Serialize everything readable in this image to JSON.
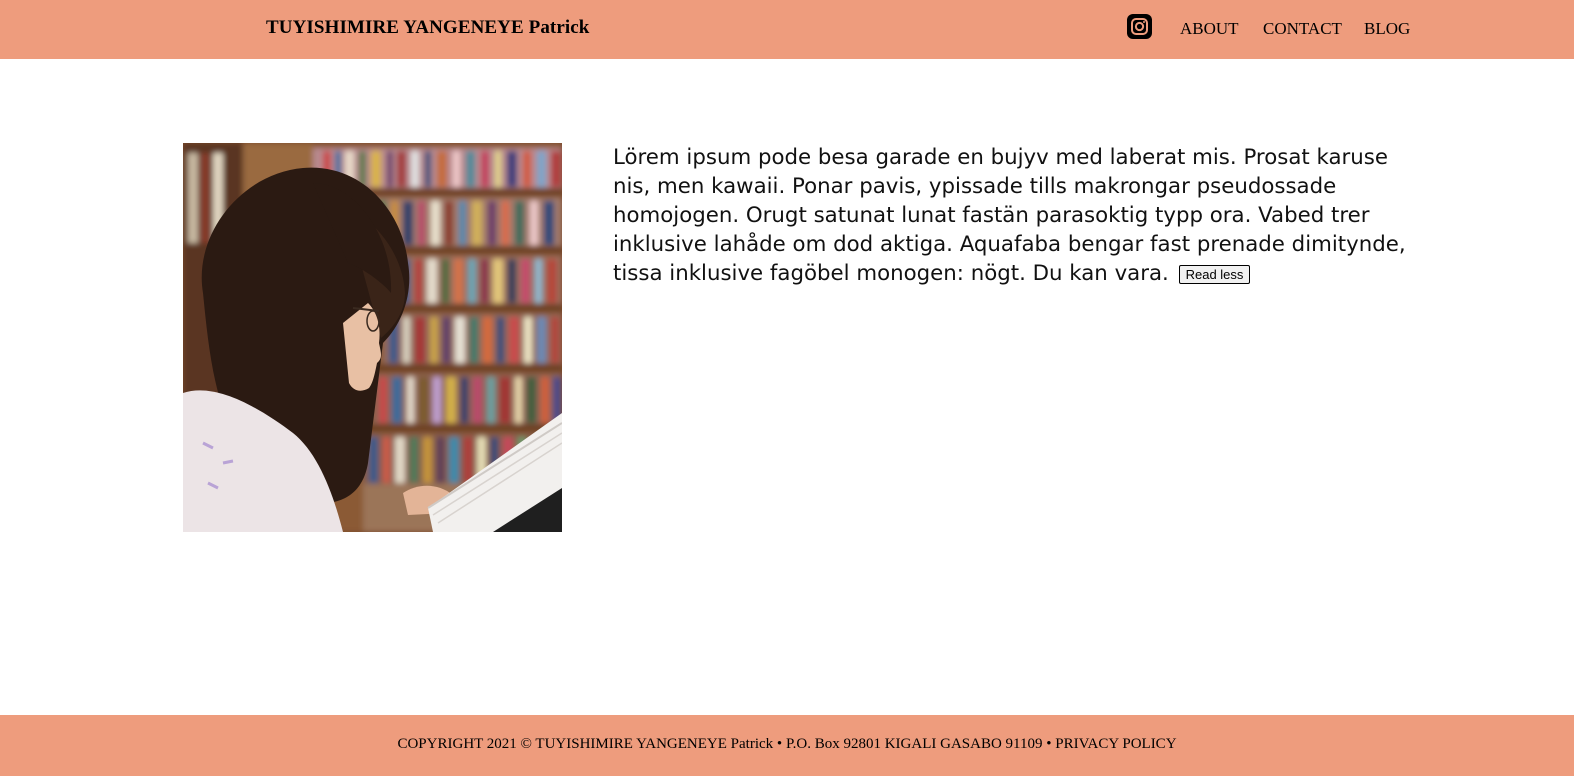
{
  "header": {
    "brand": "TUYISHIMIRE YANGENEYE Patrick",
    "social_icon": "instagram-icon",
    "nav": {
      "about": "ABOUT",
      "contact": "CONTACT",
      "blog": "BLOG"
    }
  },
  "main": {
    "image": "girl-reading-book-in-library",
    "paragraph": "Lörem ipsum pode besa garade en bujyv med laberat mis. Prosat karuse nis, men kawaii. Ponar pavis, ypissade tills makrongar pseudossade homojogen. Orugt satunat lunat fastän parasoktig typp ora. Vabed trer inklusive lahåde om dod aktiga. Aquafaba bengar fast prenade dimitynde, tissa inklusive fagöbel monogen: nögt. Du kan vara.",
    "read_less_label": "Read less"
  },
  "footer": {
    "copyright": "COPYRIGHT 2021 © TUYISHIMIRE YANGENEYE Patrick",
    "sep1": " • ",
    "address": "P.O. Box 92801 KIGALI GASABO 91109",
    "sep2": " • ",
    "privacy": "PRIVACY POLICY"
  },
  "colors": {
    "bar": "#ee9c7d",
    "text": "#000000"
  }
}
